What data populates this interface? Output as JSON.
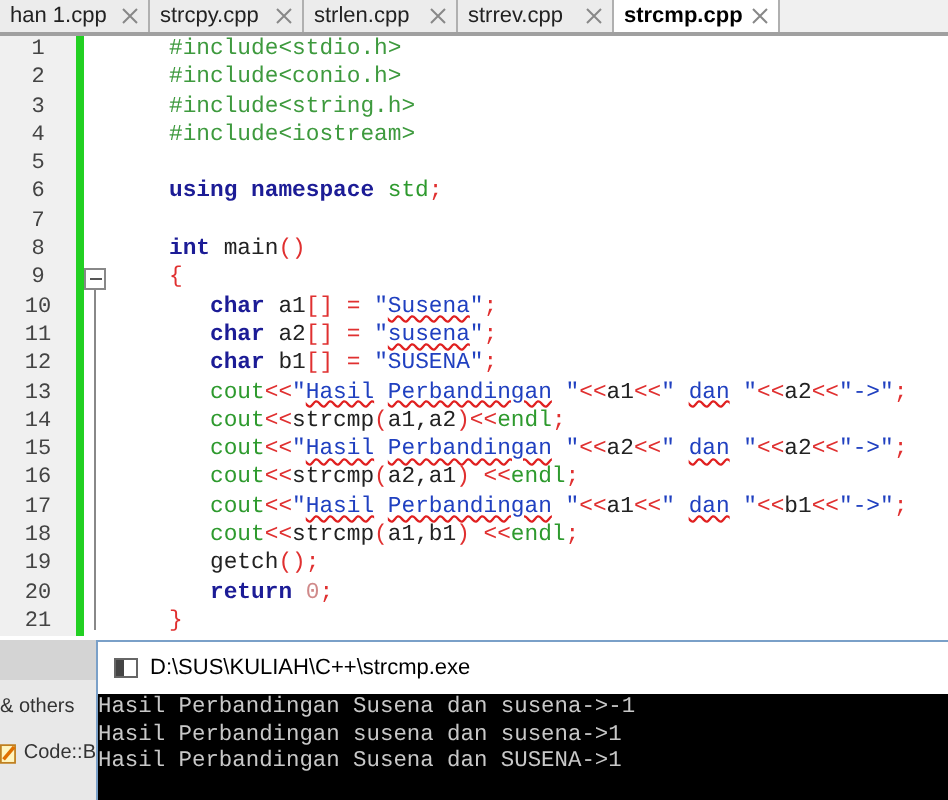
{
  "tabs": [
    {
      "label": "han 1.cpp",
      "selected": false
    },
    {
      "label": "strcpy.cpp",
      "selected": false
    },
    {
      "label": "strlen.cpp",
      "selected": false
    },
    {
      "label": "strrev.cpp",
      "selected": false
    },
    {
      "label": "strcmp.cpp",
      "selected": true
    }
  ],
  "editor": {
    "lines": [
      {
        "number": "1",
        "tokens": [
          {
            "kind": "preprocessor",
            "text": "   #include<stdio.h>"
          }
        ]
      },
      {
        "number": "2",
        "tokens": [
          {
            "kind": "preprocessor",
            "text": "   #include<conio.h>"
          }
        ]
      },
      {
        "number": "3",
        "tokens": [
          {
            "kind": "preprocessor",
            "text": "   #include<string.h>"
          }
        ]
      },
      {
        "number": "4",
        "tokens": [
          {
            "kind": "preprocessor",
            "text": "   #include<iostream>"
          }
        ]
      },
      {
        "number": "5"
      },
      {
        "number": "6",
        "tokens": [
          {
            "kind": "keyword",
            "text": "   using"
          },
          {
            "kind": "keyword",
            "text": " namespace"
          },
          {
            "kind": "builtin",
            "text": " std"
          },
          {
            "kind": "symbol",
            "text": ";"
          }
        ]
      },
      {
        "number": "7"
      },
      {
        "number": "8",
        "tokens": [
          {
            "kind": "keyword",
            "text": "   int"
          },
          {
            "kind": "plain",
            "text": " main"
          },
          {
            "kind": "symbol",
            "text": "()"
          }
        ]
      },
      {
        "number": "9",
        "fold": true,
        "tokens": [
          {
            "kind": "symbol",
            "text": "   {"
          }
        ]
      },
      {
        "number": "10",
        "tokens": [
          {
            "kind": "keyword",
            "text": "      char"
          },
          {
            "kind": "plain",
            "text": " a1"
          },
          {
            "kind": "symbol",
            "text": "[] = "
          },
          {
            "kind": "string",
            "text": "\""
          },
          {
            "kind": "string",
            "text": "Susena",
            "spell": true
          },
          {
            "kind": "string",
            "text": "\""
          },
          {
            "kind": "symbol",
            "text": ";"
          }
        ]
      },
      {
        "number": "11",
        "tokens": [
          {
            "kind": "keyword",
            "text": "      char"
          },
          {
            "kind": "plain",
            "text": " a2"
          },
          {
            "kind": "symbol",
            "text": "[] = "
          },
          {
            "kind": "string",
            "text": "\""
          },
          {
            "kind": "string",
            "text": "susena",
            "spell": true
          },
          {
            "kind": "string",
            "text": "\""
          },
          {
            "kind": "symbol",
            "text": ";"
          }
        ]
      },
      {
        "number": "12",
        "tokens": [
          {
            "kind": "keyword",
            "text": "      char"
          },
          {
            "kind": "plain",
            "text": " b1"
          },
          {
            "kind": "symbol",
            "text": "[] = "
          },
          {
            "kind": "string",
            "text": "\"SUSENA\""
          },
          {
            "kind": "symbol",
            "text": ";"
          }
        ]
      },
      {
        "number": "13",
        "tokens": [
          {
            "kind": "builtin",
            "text": "      cout"
          },
          {
            "kind": "symbol",
            "text": "<<"
          },
          {
            "kind": "string",
            "text": "\""
          },
          {
            "kind": "string",
            "text": "Hasil",
            "spell": true
          },
          {
            "kind": "string",
            "text": " Perbandingan",
            "spell": true
          },
          {
            "kind": "string",
            "text": " \""
          },
          {
            "kind": "symbol",
            "text": "<<"
          },
          {
            "kind": "plain",
            "text": "a1"
          },
          {
            "kind": "symbol",
            "text": "<<"
          },
          {
            "kind": "string",
            "text": "\""
          },
          {
            "kind": "string",
            "text": " dan",
            "spell": true
          },
          {
            "kind": "string",
            "text": " \""
          },
          {
            "kind": "symbol",
            "text": "<<"
          },
          {
            "kind": "plain",
            "text": "a2"
          },
          {
            "kind": "symbol",
            "text": "<<"
          },
          {
            "kind": "string",
            "text": "\"->\""
          },
          {
            "kind": "symbol",
            "text": ";"
          }
        ]
      },
      {
        "number": "14",
        "tokens": [
          {
            "kind": "builtin",
            "text": "      cout"
          },
          {
            "kind": "symbol",
            "text": "<<"
          },
          {
            "kind": "plain",
            "text": "strcmp"
          },
          {
            "kind": "symbol",
            "text": "("
          },
          {
            "kind": "plain",
            "text": "a1,a2"
          },
          {
            "kind": "symbol",
            "text": ")"
          },
          {
            "kind": "symbol",
            "text": "<<"
          },
          {
            "kind": "builtin",
            "text": "endl"
          },
          {
            "kind": "symbol",
            "text": ";"
          }
        ]
      },
      {
        "number": "15",
        "tokens": [
          {
            "kind": "builtin",
            "text": "      cout"
          },
          {
            "kind": "symbol",
            "text": "<<"
          },
          {
            "kind": "string",
            "text": "\""
          },
          {
            "kind": "string",
            "text": "Hasil",
            "spell": true
          },
          {
            "kind": "string",
            "text": " Perbandingan",
            "spell": true
          },
          {
            "kind": "string",
            "text": " \""
          },
          {
            "kind": "symbol",
            "text": "<<"
          },
          {
            "kind": "plain",
            "text": "a2"
          },
          {
            "kind": "symbol",
            "text": "<<"
          },
          {
            "kind": "string",
            "text": "\""
          },
          {
            "kind": "string",
            "text": " dan",
            "spell": true
          },
          {
            "kind": "string",
            "text": " \""
          },
          {
            "kind": "symbol",
            "text": "<<"
          },
          {
            "kind": "plain",
            "text": "a2"
          },
          {
            "kind": "symbol",
            "text": "<<"
          },
          {
            "kind": "string",
            "text": "\"->\""
          },
          {
            "kind": "symbol",
            "text": ";"
          }
        ]
      },
      {
        "number": "16",
        "tokens": [
          {
            "kind": "builtin",
            "text": "      cout"
          },
          {
            "kind": "symbol",
            "text": "<<"
          },
          {
            "kind": "plain",
            "text": "strcmp"
          },
          {
            "kind": "symbol",
            "text": "("
          },
          {
            "kind": "plain",
            "text": "a2,a1"
          },
          {
            "kind": "symbol",
            "text": ") <<"
          },
          {
            "kind": "builtin",
            "text": "endl"
          },
          {
            "kind": "symbol",
            "text": ";"
          }
        ]
      },
      {
        "number": "17",
        "tokens": [
          {
            "kind": "builtin",
            "text": "      cout"
          },
          {
            "kind": "symbol",
            "text": "<<"
          },
          {
            "kind": "string",
            "text": "\""
          },
          {
            "kind": "string",
            "text": "Hasil",
            "spell": true
          },
          {
            "kind": "string",
            "text": " Perbandingan",
            "spell": true
          },
          {
            "kind": "string",
            "text": " \""
          },
          {
            "kind": "symbol",
            "text": "<<"
          },
          {
            "kind": "plain",
            "text": "a1"
          },
          {
            "kind": "symbol",
            "text": "<<"
          },
          {
            "kind": "string",
            "text": "\""
          },
          {
            "kind": "string",
            "text": " dan",
            "spell": true
          },
          {
            "kind": "string",
            "text": " \""
          },
          {
            "kind": "symbol",
            "text": "<<"
          },
          {
            "kind": "plain",
            "text": "b1"
          },
          {
            "kind": "symbol",
            "text": "<<"
          },
          {
            "kind": "string",
            "text": "\"->\""
          },
          {
            "kind": "symbol",
            "text": ";"
          }
        ]
      },
      {
        "number": "18",
        "tokens": [
          {
            "kind": "builtin",
            "text": "      cout"
          },
          {
            "kind": "symbol",
            "text": "<<"
          },
          {
            "kind": "plain",
            "text": "strcmp"
          },
          {
            "kind": "symbol",
            "text": "("
          },
          {
            "kind": "plain",
            "text": "a1,b1"
          },
          {
            "kind": "symbol",
            "text": ") <<"
          },
          {
            "kind": "builtin",
            "text": "endl"
          },
          {
            "kind": "symbol",
            "text": ";"
          }
        ]
      },
      {
        "number": "19",
        "tokens": [
          {
            "kind": "plain",
            "text": "      getch"
          },
          {
            "kind": "symbol",
            "text": "();"
          }
        ]
      },
      {
        "number": "20",
        "tokens": [
          {
            "kind": "keyword",
            "text": "      return"
          },
          {
            "kind": "number",
            "text": " 0"
          },
          {
            "kind": "symbol",
            "text": ";"
          }
        ]
      },
      {
        "number": "21",
        "tokens": [
          {
            "kind": "symbol",
            "text": "   }"
          }
        ]
      }
    ]
  },
  "background_panel": {
    "tab": "& others",
    "item": "Code::B"
  },
  "console": {
    "title": "D:\\SUS\\KULIAH\\C++\\strcmp.exe",
    "lines": [
      "Hasil Perbandingan Susena dan susena->-1",
      "Hasil Perbandingan susena dan susena->1",
      "Hasil Perbandingan Susena dan SUSENA->1"
    ]
  }
}
